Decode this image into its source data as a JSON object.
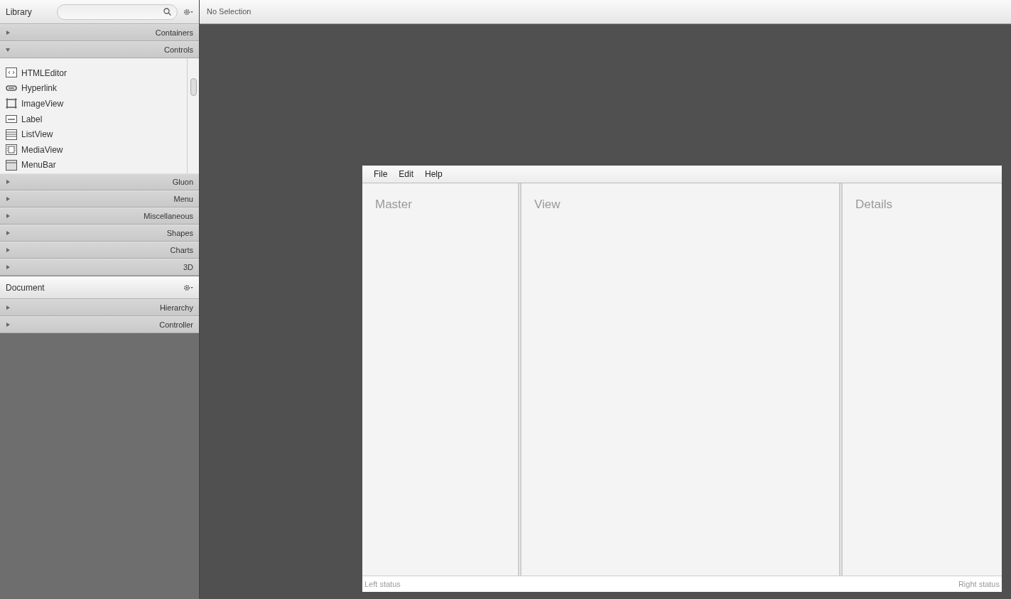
{
  "library": {
    "title": "Library",
    "sections": [
      {
        "label": "Containers",
        "expanded": false
      },
      {
        "label": "Controls",
        "expanded": true,
        "items": [
          {
            "label": "HTMLEditor",
            "kind": "html"
          },
          {
            "label": "Hyperlink",
            "kind": "link"
          },
          {
            "label": "ImageView",
            "kind": "image"
          },
          {
            "label": "Label",
            "kind": "label"
          },
          {
            "label": "ListView",
            "kind": "list"
          },
          {
            "label": "MediaView",
            "kind": "media"
          },
          {
            "label": "MenuBar",
            "kind": "menubar"
          }
        ]
      },
      {
        "label": "Gluon",
        "expanded": false
      },
      {
        "label": "Menu",
        "expanded": false
      },
      {
        "label": "Miscellaneous",
        "expanded": false
      },
      {
        "label": "Shapes",
        "expanded": false
      },
      {
        "label": "Charts",
        "expanded": false
      },
      {
        "label": "3D",
        "expanded": false
      }
    ]
  },
  "document": {
    "title": "Document",
    "sections": [
      {
        "label": "Hierarchy",
        "expanded": false
      },
      {
        "label": "Controller",
        "expanded": false
      }
    ]
  },
  "selection": "No Selection",
  "preview": {
    "menus": [
      "File",
      "Edit",
      "Help"
    ],
    "panes": [
      "Master",
      "View",
      "Details"
    ],
    "status_left": "Left status",
    "status_right": "Right status"
  }
}
